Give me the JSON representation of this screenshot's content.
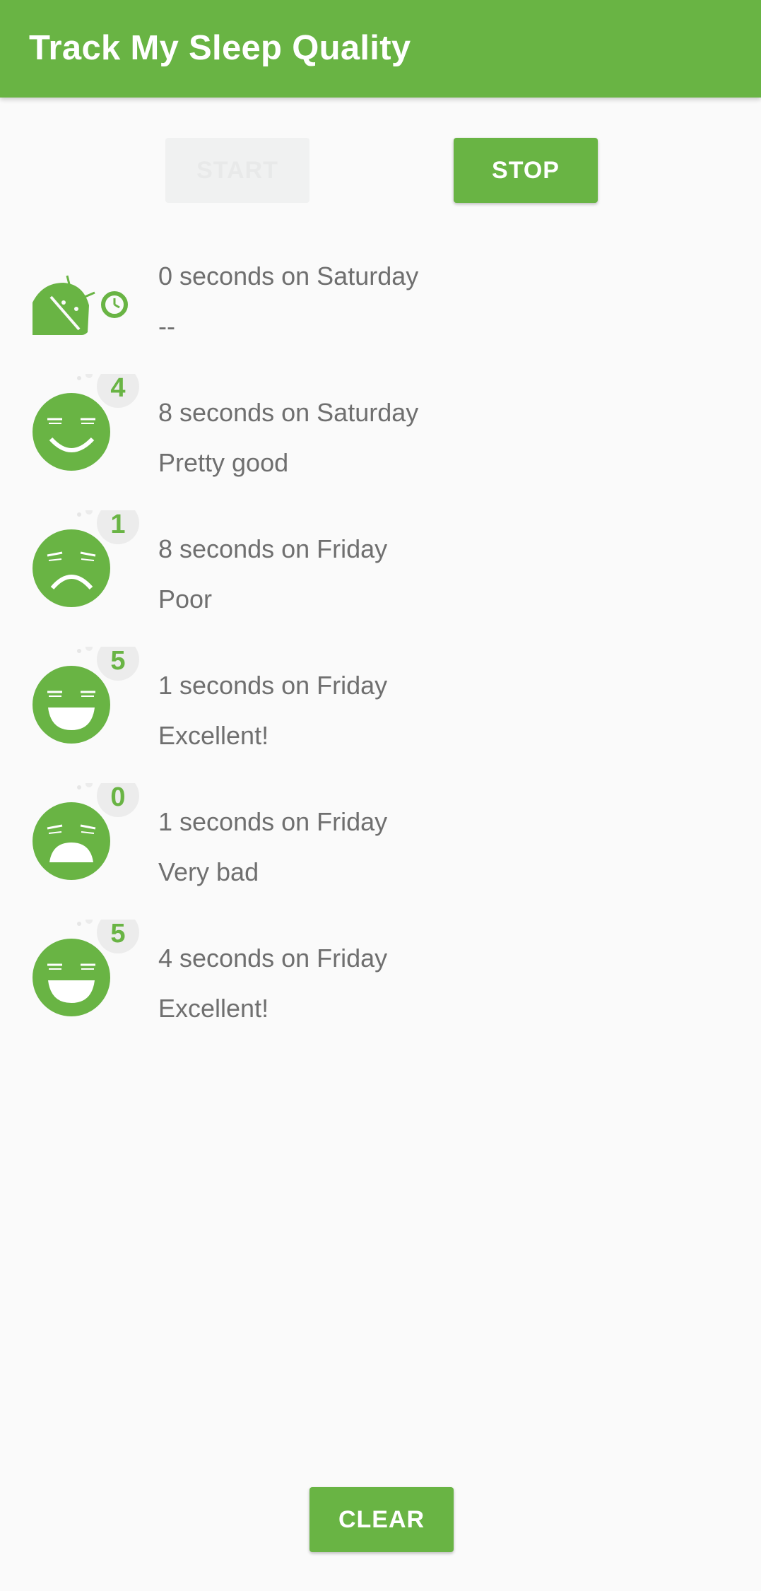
{
  "app": {
    "title": "Track My Sleep Quality"
  },
  "controls": {
    "start_label": "START",
    "stop_label": "STOP",
    "clear_label": "CLEAR"
  },
  "colors": {
    "primary": "#69b444",
    "background": "#fafafa",
    "text_secondary": "#6f6f6f",
    "disabled_button": "#f0f1f1"
  },
  "nights": [
    {
      "duration": "0 seconds on Saturday",
      "quality": "--",
      "rating": "",
      "icon": "sleep-active-icon"
    },
    {
      "duration": "8 seconds on Saturday",
      "quality": "Pretty good",
      "rating": "4",
      "icon": "smile-face-icon"
    },
    {
      "duration": "8 seconds on Friday",
      "quality": "Poor",
      "rating": "1",
      "icon": "frown-face-icon"
    },
    {
      "duration": "1 seconds on Friday",
      "quality": "Excellent!",
      "rating": "5",
      "icon": "laugh-face-icon"
    },
    {
      "duration": "1 seconds on Friday",
      "quality": "Very bad",
      "rating": "0",
      "icon": "grimace-face-icon"
    },
    {
      "duration": "4 seconds on Friday",
      "quality": "Excellent!",
      "rating": "5",
      "icon": "laugh-face-icon"
    }
  ]
}
